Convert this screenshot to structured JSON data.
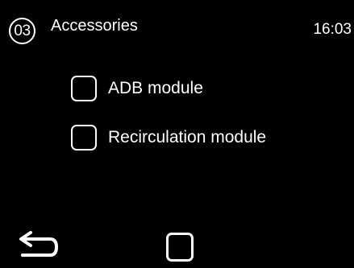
{
  "header": {
    "step_number": "03",
    "title": "Accessories",
    "time": "16:03"
  },
  "options": [
    {
      "label": "ADB module",
      "checked": false
    },
    {
      "label": "Recirculation module",
      "checked": false
    }
  ],
  "footer": {
    "back_icon": "back-arrow-icon",
    "home_icon": "home-square-icon"
  },
  "colors": {
    "background": "#000000",
    "foreground": "#ffffff"
  }
}
